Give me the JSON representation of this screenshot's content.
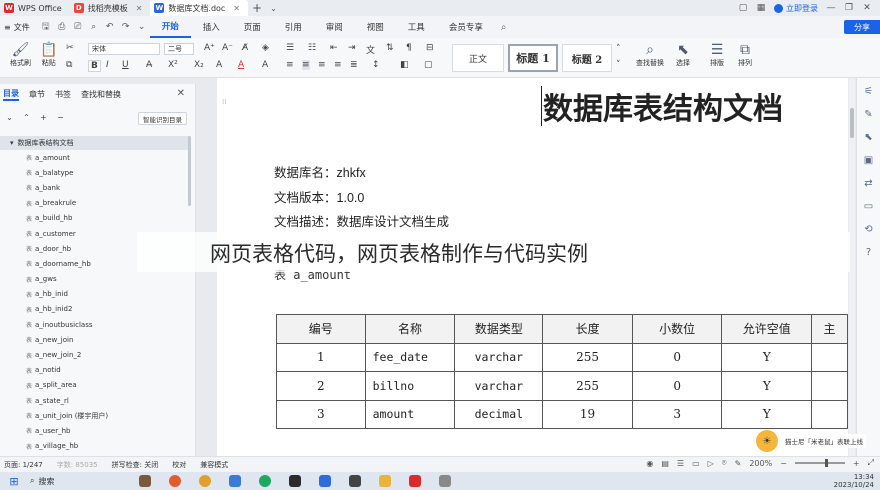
{
  "titlebar": {
    "tabs": [
      {
        "label": "WPS Office",
        "color": "#d92b2b",
        "letter": "W"
      },
      {
        "label": "找稻壳模板",
        "color": "#e8463a",
        "letter": "D"
      },
      {
        "label": "数据库文档.doc",
        "color": "#2b66d9",
        "letter": "W"
      }
    ],
    "login_label": "立即登录"
  },
  "menubar": {
    "file_label": "文件",
    "items": [
      "开始",
      "插入",
      "页面",
      "引用",
      "审阅",
      "视图",
      "工具",
      "会员专享"
    ],
    "active_index": 0,
    "share_label": "分享"
  },
  "ribbon": {
    "format_painter": "格式刷",
    "paste": "粘贴",
    "font_name": "宋体",
    "font_size": "二号",
    "style_normal": "正文",
    "style_h1": "标题 1",
    "style_h2": "标题 2",
    "find_replace": "查找替换",
    "select": "选择",
    "layout": "排版",
    "arrange": "排列"
  },
  "leftpanel": {
    "tabs": [
      "目录",
      "章节",
      "书签",
      "查找和替换"
    ],
    "active_tab": 0,
    "smart_btn": "智能识别目录",
    "root": "数据库表结构文档",
    "items": [
      "a_amount",
      "a_balatype",
      "a_bank",
      "a_breakrule",
      "a_build_hb",
      "a_customer",
      "a_door_hb",
      "a_doorname_hb",
      "a_gws",
      "a_hb_inid",
      "a_hb_inid2",
      "a_inoutbusiclass",
      "a_new_join",
      "a_new_join_2",
      "a_notid",
      "a_split_area",
      "a_state_rl",
      "a_unit_join (楼宇用户)",
      "a_user_hb",
      "a_village_hb"
    ],
    "item_prefix": "表"
  },
  "document": {
    "title": "数据库表结构文档",
    "meta": [
      {
        "label": "数据库名：",
        "value": "zhkfx"
      },
      {
        "label": "文档版本：",
        "value": "1.0.0"
      },
      {
        "label": "文档描述：",
        "value": "数据库设计文档生成"
      }
    ],
    "table_caption": "表 a_amount",
    "table": {
      "headers": [
        "编号",
        "名称",
        "数据类型",
        "长度",
        "小数位",
        "允许空值",
        "主"
      ],
      "rows": [
        [
          "1",
          "fee_date",
          "varchar",
          "255",
          "0",
          "Y",
          ""
        ],
        [
          "2",
          "billno",
          "varchar",
          "255",
          "0",
          "Y",
          ""
        ],
        [
          "3",
          "amount",
          "decimal",
          "19",
          "3",
          "Y",
          ""
        ]
      ]
    }
  },
  "overlay_text": "网页表格代码，网页表格制作与代码实例",
  "notify_text": "猫士尼「米老鼠」表联上线",
  "statusbar": {
    "page": "页面: 1/247",
    "words": "字数: 85035",
    "spell": "拼写检查: 关闭",
    "proof": "校对",
    "compat": "兼容模式",
    "zoom": "200%"
  },
  "taskbar": {
    "search": "搜索",
    "time": "13:34",
    "date": "2023/10/24"
  }
}
